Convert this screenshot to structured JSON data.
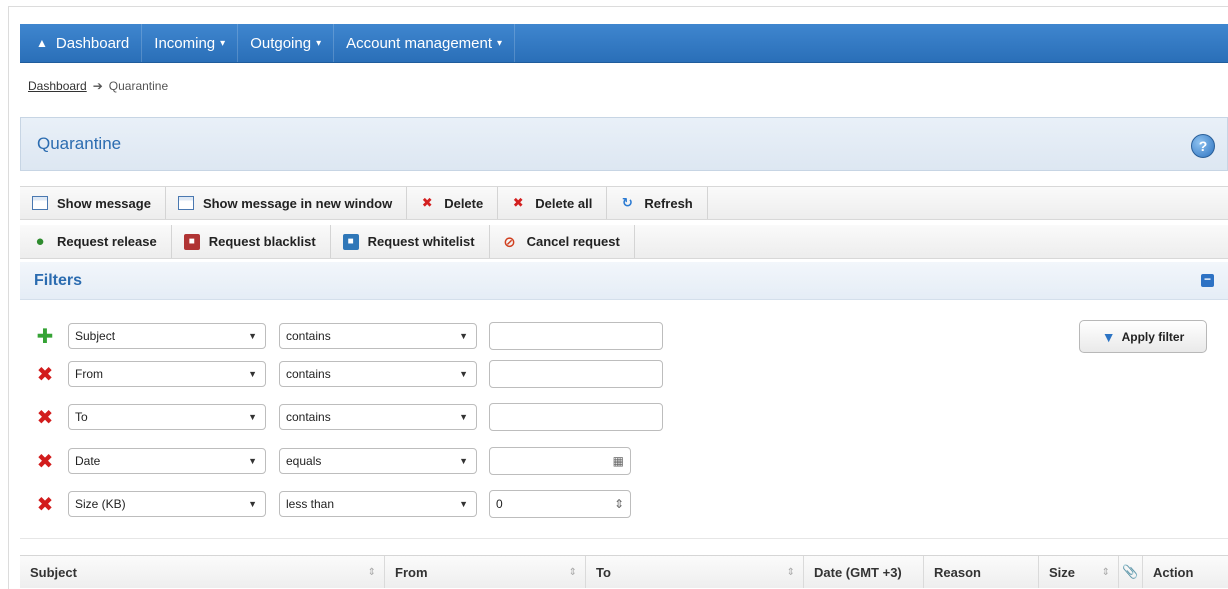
{
  "nav": {
    "items": [
      {
        "label": "Dashboard",
        "icon": "home-icon"
      },
      {
        "label": "Incoming",
        "caret": "▾"
      },
      {
        "label": "Outgoing",
        "caret": "▾"
      },
      {
        "label": "Account management",
        "caret": "▾"
      }
    ]
  },
  "breadcrumb": {
    "root": "Dashboard",
    "current": "Quarantine"
  },
  "page": {
    "title": "Quarantine",
    "help_icon": "help-icon"
  },
  "toolbar1": [
    {
      "label": "Show message",
      "icon": "window-icon"
    },
    {
      "label": "Show message in new window",
      "icon": "window-icon"
    },
    {
      "label": "Delete",
      "icon": "delete-icon"
    },
    {
      "label": "Delete all",
      "icon": "delete-all-icon"
    },
    {
      "label": "Refresh",
      "icon": "refresh-icon"
    }
  ],
  "toolbar2": [
    {
      "label": "Request release",
      "icon": "release-icon"
    },
    {
      "label": "Request blacklist",
      "icon": "blacklist-icon"
    },
    {
      "label": "Request whitelist",
      "icon": "whitelist-icon"
    },
    {
      "label": "Cancel request",
      "icon": "cancel-icon"
    }
  ],
  "filters": {
    "title": "Filters",
    "apply_label": "Apply filter",
    "rows": [
      {
        "field": "Subject",
        "operator": "contains",
        "value": ""
      },
      {
        "field": "From",
        "operator": "contains",
        "value": ""
      },
      {
        "field": "To",
        "operator": "contains",
        "value": ""
      },
      {
        "field": "Date",
        "operator": "equals",
        "value": ""
      },
      {
        "field": "Size (KB)",
        "operator": "less than",
        "value": "0"
      }
    ]
  },
  "table": {
    "columns": [
      "Subject",
      "From",
      "To",
      "Date (GMT +3)",
      "Reason",
      "Size",
      "",
      "Action"
    ]
  },
  "colors": {
    "nav_blue": "#2f7ac4",
    "title_blue": "#2b6cb0",
    "delete_red": "#d21c1c",
    "add_green": "#35a335"
  }
}
